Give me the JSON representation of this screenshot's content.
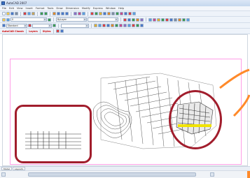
{
  "window": {
    "title": "AutoCAD 2007"
  },
  "menu": {
    "items": [
      "File",
      "Edit",
      "View",
      "Insert",
      "Format",
      "Tools",
      "Draw",
      "Dimension",
      "Modify",
      "Express",
      "Window",
      "Help"
    ]
  },
  "toolbars": {
    "layer_dropdown": "0",
    "linetype_dropdown": "ByLayer",
    "style_dropdown": "Standard",
    "red_labels": [
      "AutoCAD Classic",
      "Layers",
      "Styles"
    ]
  },
  "layout_tabs": [
    "Model",
    "Layout1"
  ],
  "colors": {
    "callout": "#a11d2c",
    "paper_frame": "#ff9ee6",
    "accent": "#ff8a2a"
  },
  "icons": [
    "new-icon",
    "open-icon",
    "save-icon",
    "print-icon",
    "zoom-icon",
    "pan-icon",
    "layer-icon",
    "line-icon",
    "circle-icon",
    "erase-icon"
  ]
}
